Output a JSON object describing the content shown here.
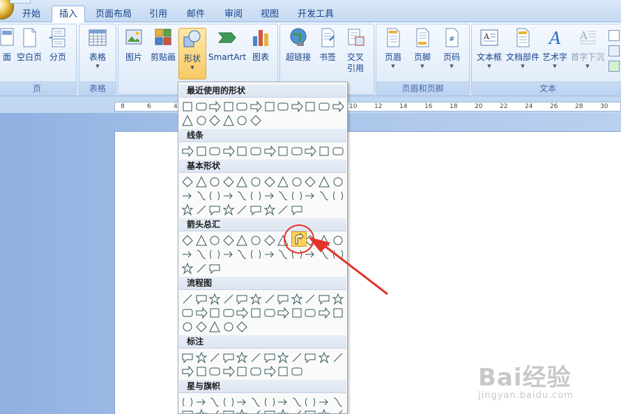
{
  "tabs": [
    "开始",
    "插入",
    "页面布局",
    "引用",
    "邮件",
    "审阅",
    "视图",
    "开发工具"
  ],
  "active_tab": "插入",
  "groups": {
    "pages": {
      "label": "页",
      "buttons": [
        "面",
        "空白页",
        "分页"
      ]
    },
    "tables": {
      "label": "表格",
      "buttons": [
        "表格"
      ]
    },
    "illustrations": {
      "buttons": [
        "图片",
        "剪贴画",
        "形状",
        "SmartArt",
        "图表"
      ]
    },
    "links": {
      "buttons": [
        "超链接",
        "书签",
        "交叉",
        "引用"
      ]
    },
    "header_footer": {
      "label": "页眉和页脚",
      "buttons": [
        "页眉",
        "页脚",
        "页码"
      ]
    },
    "text": {
      "label": "文本",
      "buttons": [
        "文本框",
        "文档部件",
        "艺术字",
        "首字下沉"
      ]
    }
  },
  "ruler": [
    "8",
    "6",
    "4",
    "10",
    "12",
    "14",
    "16",
    "18",
    "20",
    "22",
    "24",
    "26",
    "28",
    "30"
  ],
  "shapes_menu": {
    "sections": [
      "最近使用的形状",
      "线条",
      "基本形状",
      "箭头总汇",
      "流程图",
      "标注",
      "星与旗帜"
    ],
    "highlighted_shape": "arrow-u-turn-icon"
  },
  "watermark": {
    "logo": "Bai经验",
    "sub": "jingyan.baidu.com"
  },
  "colors": {
    "accent": "#15428b",
    "circle": "#e53128",
    "highlight": "#fbd25c"
  }
}
